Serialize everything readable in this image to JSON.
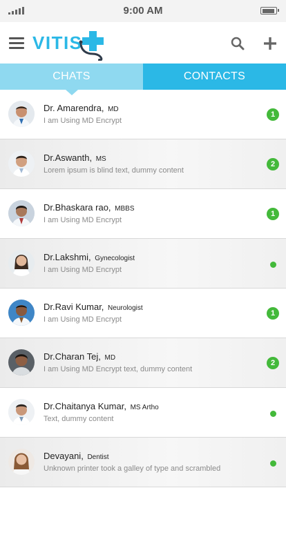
{
  "status_bar": {
    "time": "9:00 AM"
  },
  "header": {
    "logo_text": "VITIS",
    "menu_icon": "hamburger-menu-icon",
    "search_icon": "search-icon",
    "add_icon": "plus-icon"
  },
  "tabs": [
    {
      "label": "CHATS",
      "active": true
    },
    {
      "label": "CONTACTS",
      "active": false
    }
  ],
  "colors": {
    "tab_active": "#8fd9f0",
    "tab_inactive": "#2bb8e6",
    "badge": "#43b93a",
    "logo_blue": "#2bb8e6"
  },
  "chats": [
    {
      "name": "Dr. Amarendra,",
      "qual": "MD",
      "message": "I am Using MD Encrypt",
      "unread": "1"
    },
    {
      "name": "Dr.Aswanth,",
      "qual": "MS",
      "message": "Lorem ipsum is blind text, dummy content",
      "unread": "2"
    },
    {
      "name": "Dr.Bhaskara rao,",
      "qual": "MBBS",
      "message": "I am Using MD Encrypt",
      "unread": "1"
    },
    {
      "name": "Dr.Lakshmi,",
      "qual": "Gynecologist",
      "message": "I am Using MD Encrypt",
      "unread": ""
    },
    {
      "name": "Dr.Ravi Kumar,",
      "qual": "Neurologist",
      "message": "I am Using MD Encrypt",
      "unread": "1"
    },
    {
      "name": "Dr.Charan Tej,",
      "qual": "MD",
      "message": "I am Using MD Encrypt text, dummy content",
      "unread": "2"
    },
    {
      "name": "Dr.Chaitanya Kumar,",
      "qual": "MS Artho",
      "message": "Text, dummy content",
      "unread": ""
    },
    {
      "name": "Devayani,",
      "qual": "Dentist",
      "message": "Unknown printer took a galley of type and scrambled",
      "unread": ""
    }
  ]
}
